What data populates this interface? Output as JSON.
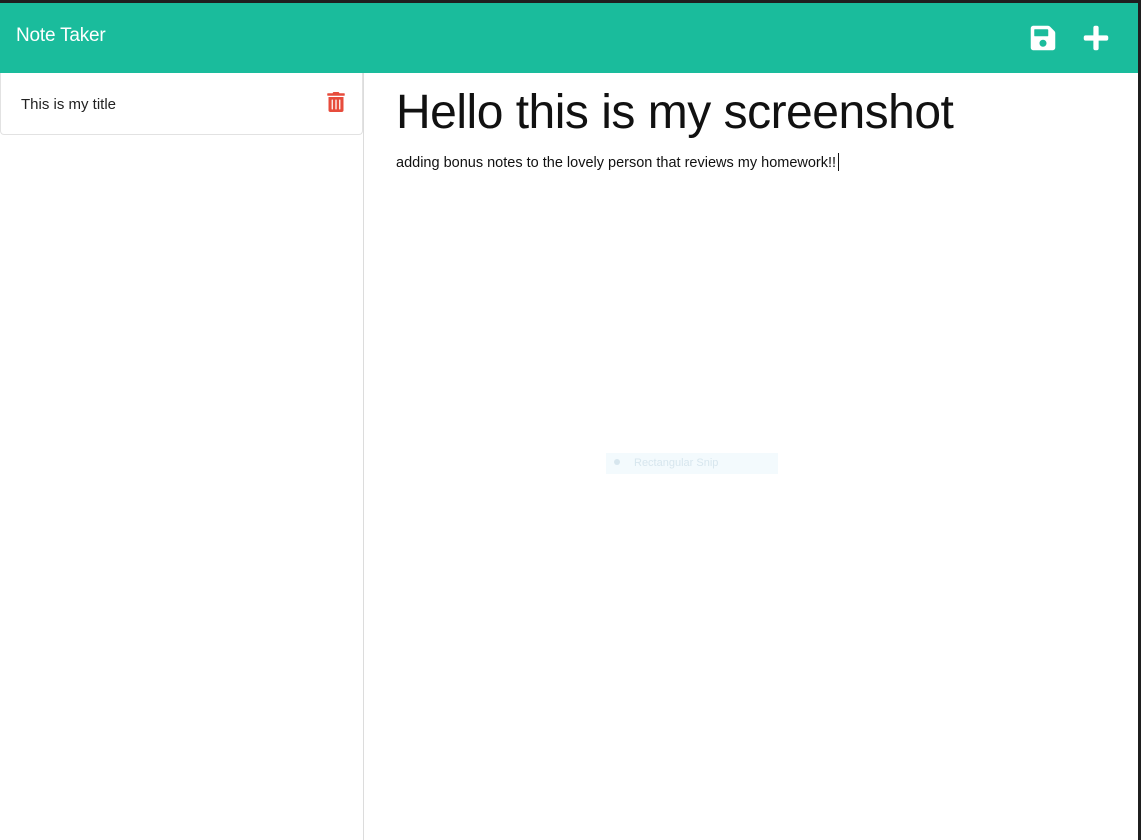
{
  "app": {
    "brand": "Note Taker",
    "accent_color": "#1abc9c",
    "delete_color": "#e74c3c"
  },
  "toolbar": {
    "save_icon": "floppy-disk-icon",
    "new_icon": "plus-icon"
  },
  "sidebar": {
    "notes": [
      {
        "title": "This is my title",
        "delete_icon": "trash-icon"
      }
    ]
  },
  "editor": {
    "title": "Hello this is my screenshot",
    "body": "adding bonus notes to the lovely person that reviews my homework!!"
  },
  "overlay": {
    "snip_label": "Rectangular Snip"
  }
}
